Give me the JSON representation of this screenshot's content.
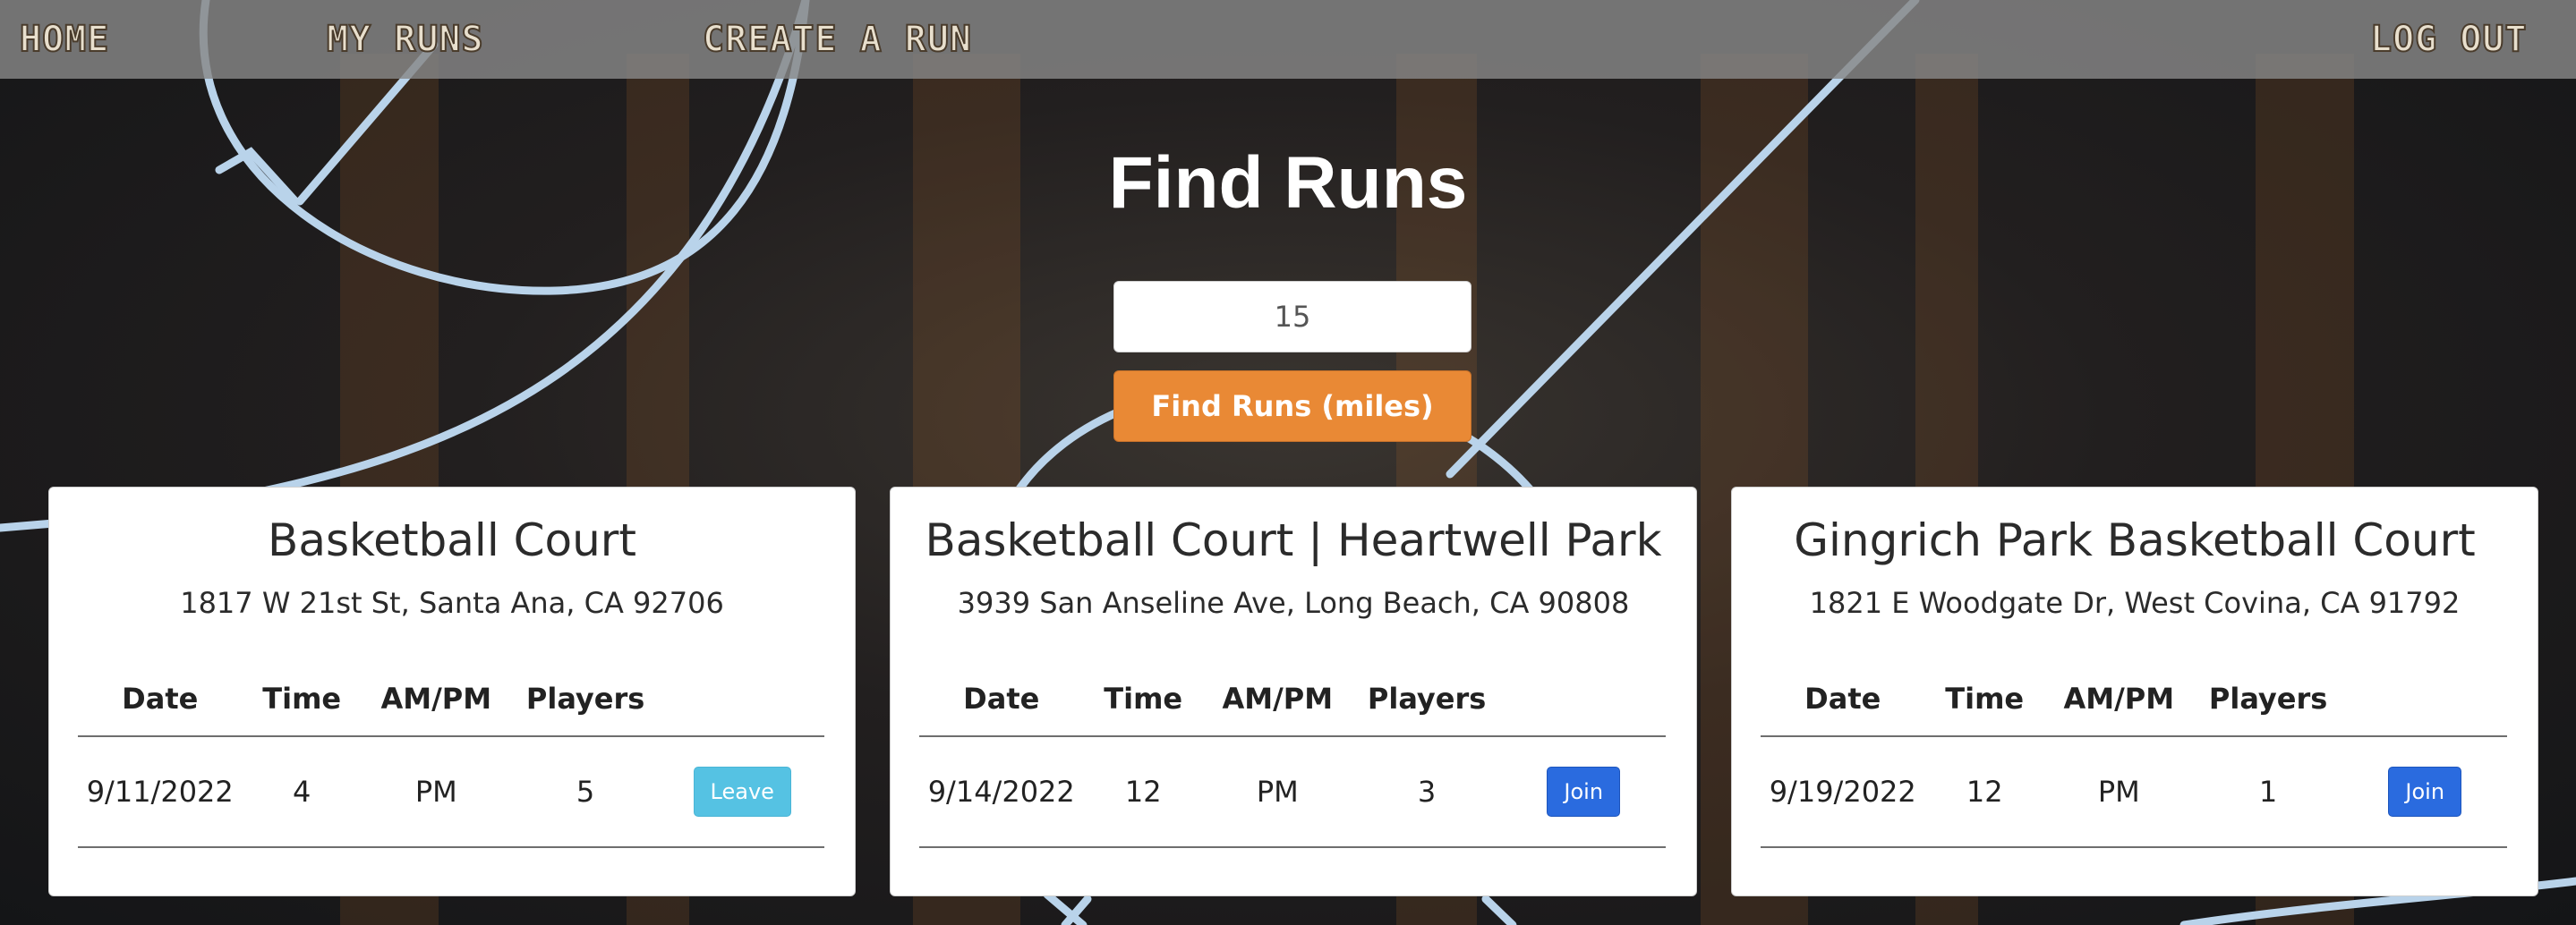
{
  "nav": {
    "home": "Home",
    "my_runs": "My Runs",
    "create_run": "Create A Run",
    "log_out": "Log Out"
  },
  "page": {
    "title": "Find Runs"
  },
  "search": {
    "distance_value": "15",
    "button_label": "Find Runs (miles)"
  },
  "table_headers": [
    "Date",
    "Time",
    "AM/PM",
    "Players"
  ],
  "courts": [
    {
      "name": "Basketball Court",
      "address": "1817 W 21st St, Santa Ana, CA 92706",
      "runs": [
        {
          "date": "9/11/2022",
          "time": "4",
          "ampm": "PM",
          "players": "5",
          "action": "Leave"
        }
      ]
    },
    {
      "name": "Basketball Court | Heartwell Park",
      "address": "3939 San Anseline Ave, Long Beach, CA 90808",
      "runs": [
        {
          "date": "9/14/2022",
          "time": "12",
          "ampm": "PM",
          "players": "3",
          "action": "Join"
        }
      ]
    },
    {
      "name": "Gingrich Park Basketball Court",
      "address": "1821 E Woodgate Dr, West Covina, CA 91792",
      "runs": [
        {
          "date": "9/19/2022",
          "time": "12",
          "ampm": "PM",
          "players": "1",
          "action": "Join"
        }
      ]
    }
  ],
  "colors": {
    "find_button": "#e98935",
    "join_button": "#2a6bdf",
    "leave_button": "#55c2e3",
    "navbar": "#878787"
  }
}
